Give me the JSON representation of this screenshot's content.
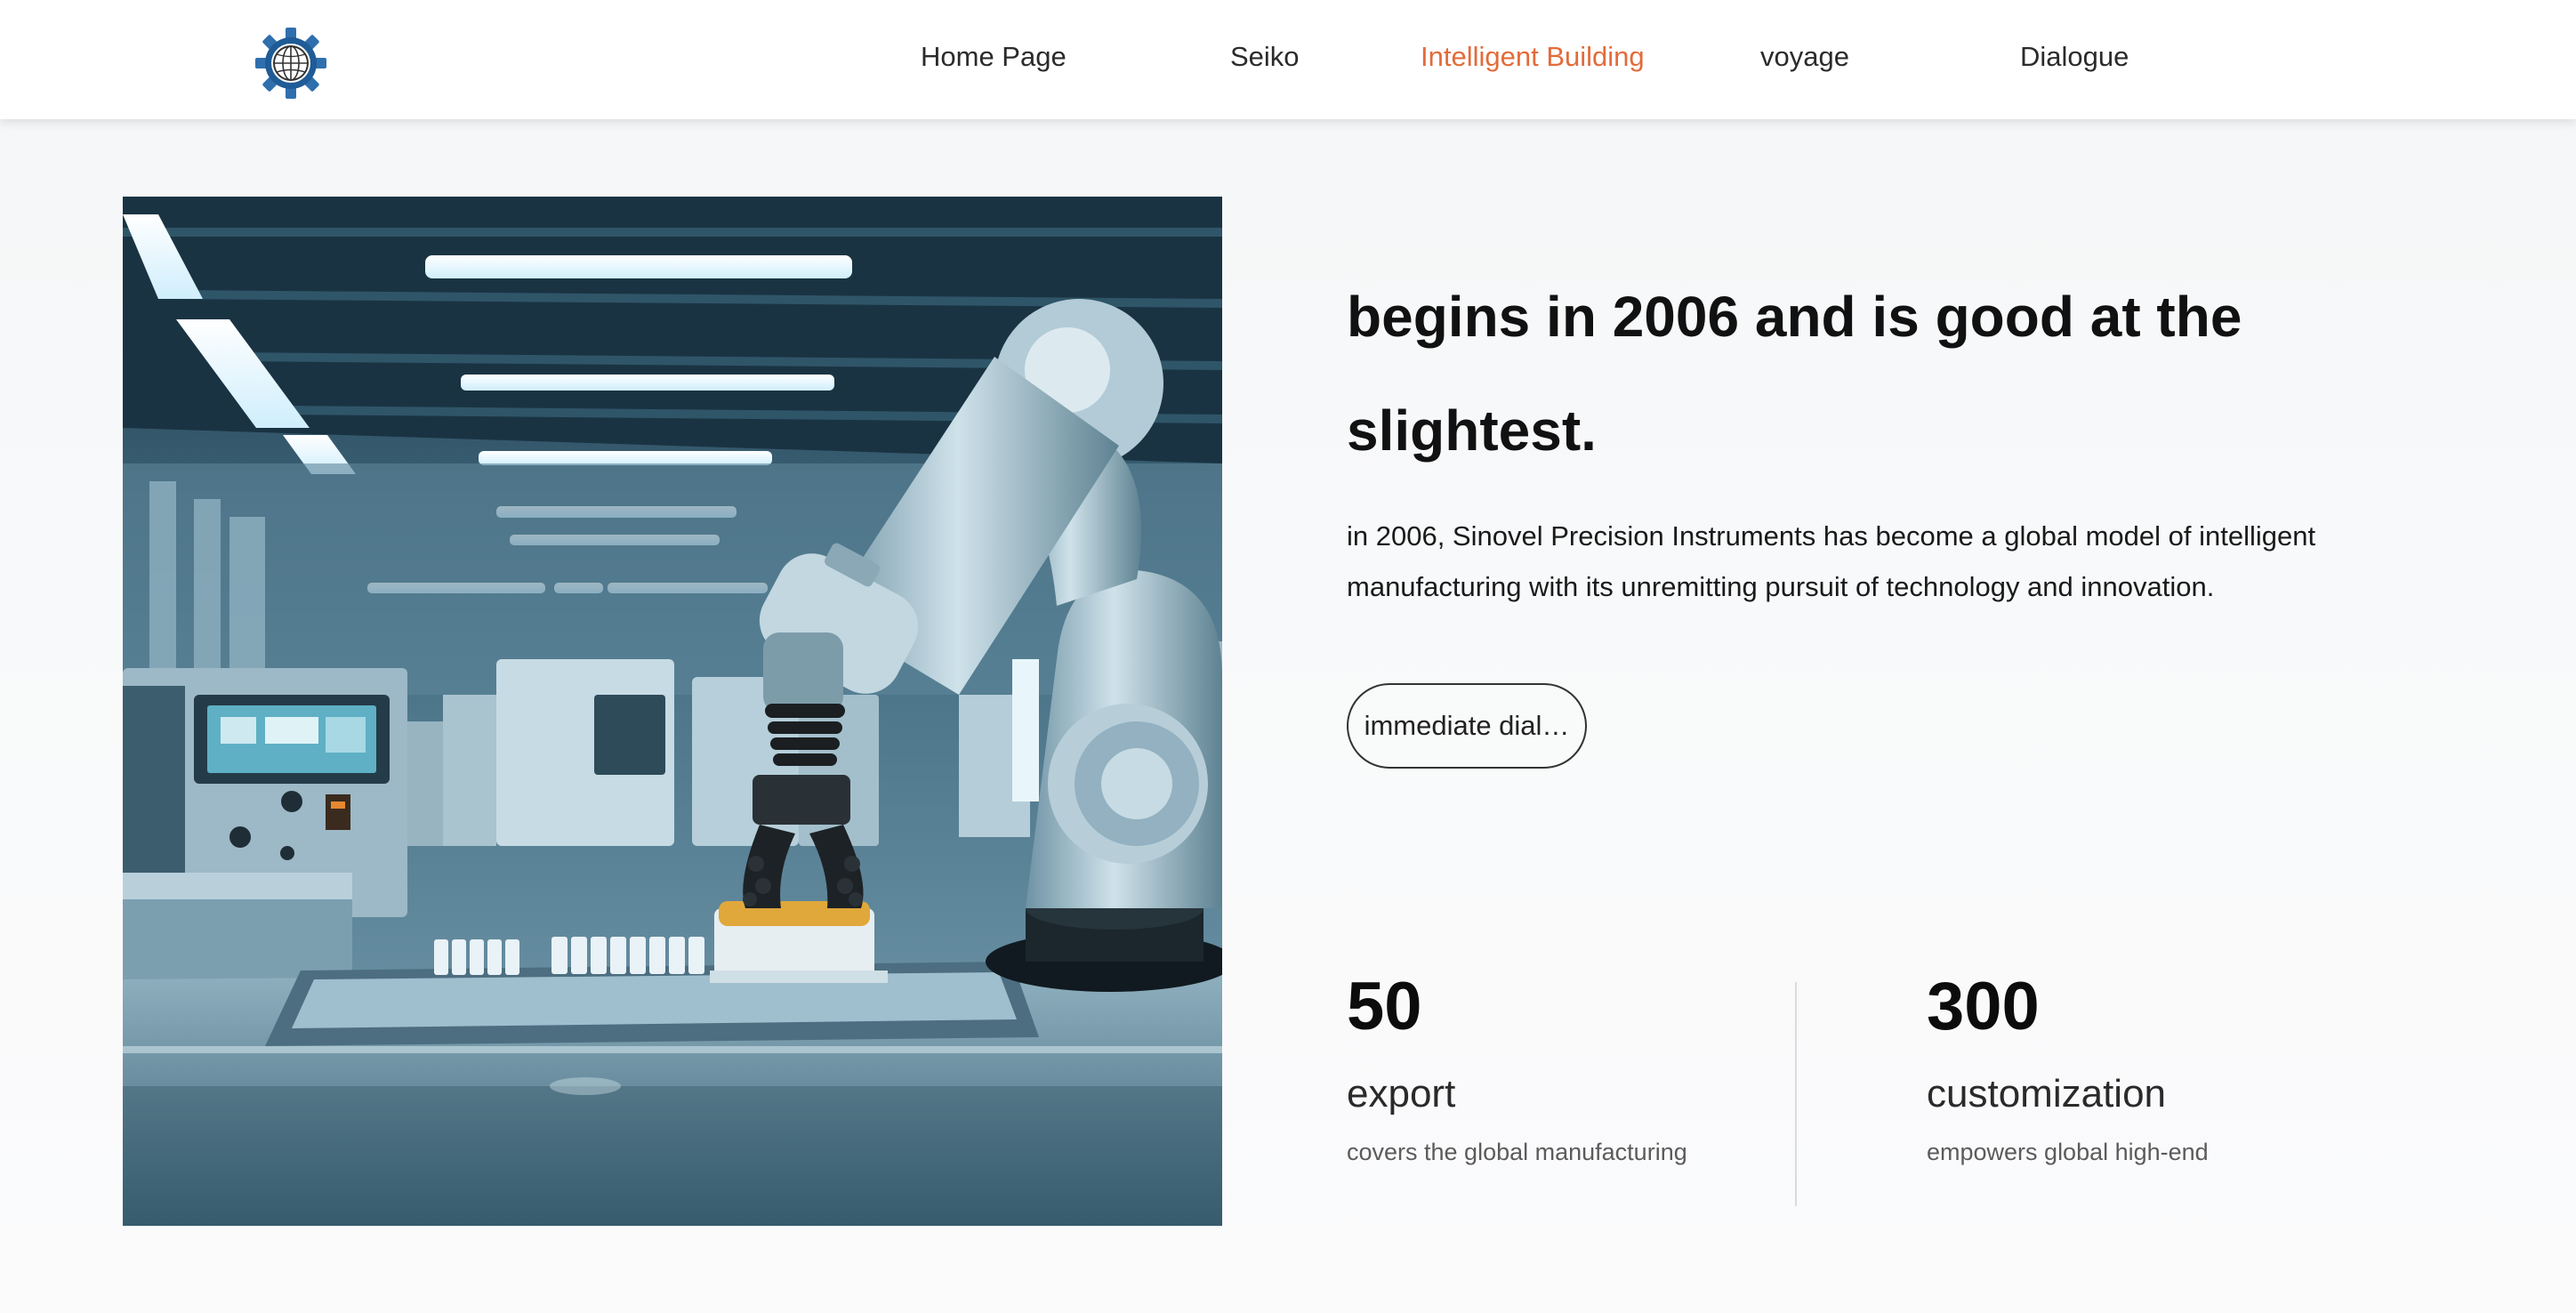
{
  "nav": {
    "items": [
      {
        "label": "Home Page",
        "active": false
      },
      {
        "label": "Seiko",
        "active": false
      },
      {
        "label": "Intelligent Building",
        "active": true
      },
      {
        "label": "voyage",
        "active": false
      },
      {
        "label": "Dialogue",
        "active": false
      }
    ],
    "active_color": "#e36b3a"
  },
  "logo": {
    "icon": "globe-gear-icon"
  },
  "hero": {
    "image": "robotic-arm-laboratory"
  },
  "content": {
    "headline": "begins in 2006 and is good at the slightest.",
    "description": "in 2006, Sinovel Precision Instruments has become a global model of intelligent manufacturing with its unremitting pursuit of technology and innovation.",
    "cta_label": "immediate dial…"
  },
  "stats": [
    {
      "value": "50",
      "label": "export",
      "sub": "covers the global manufacturing"
    },
    {
      "value": "300",
      "label": "customization",
      "sub": "empowers global high-end"
    }
  ]
}
